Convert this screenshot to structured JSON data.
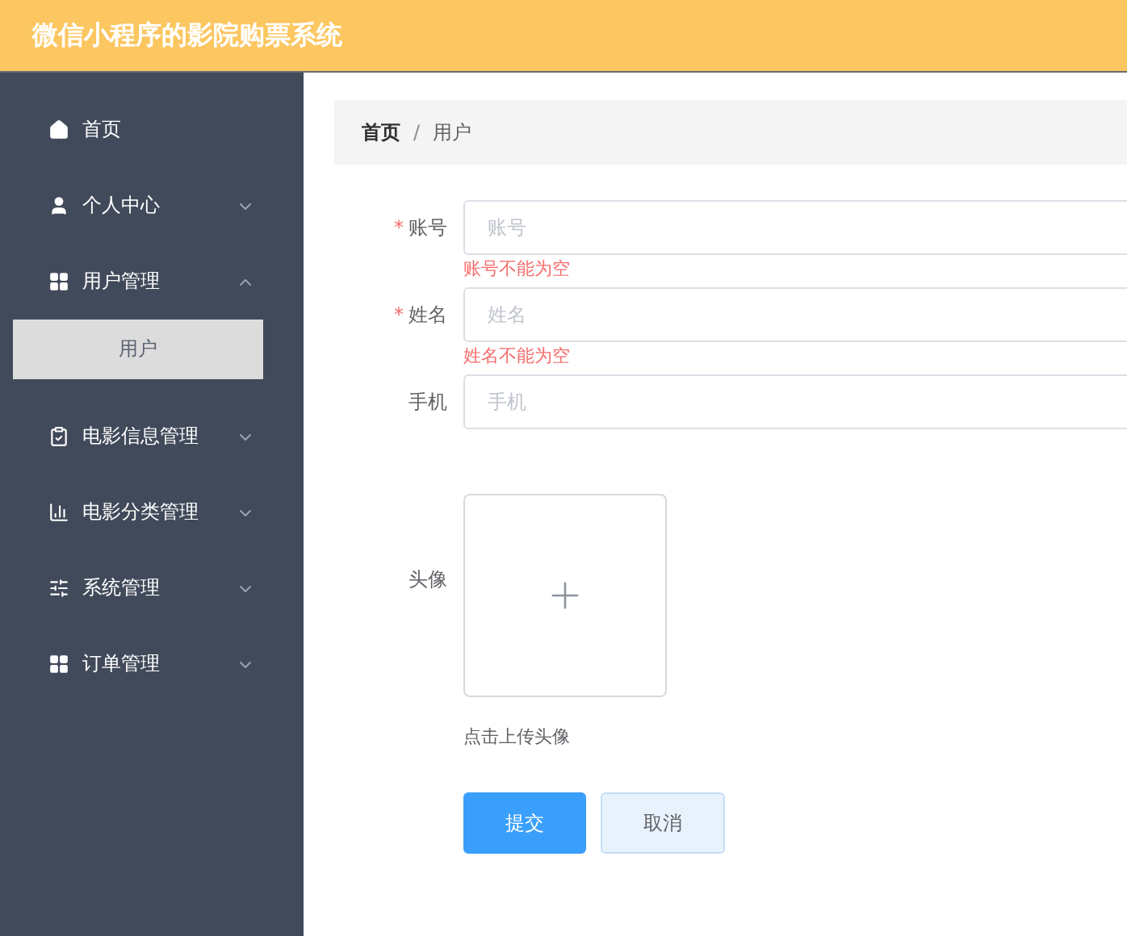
{
  "header": {
    "title": "微信小程序的影院购票系统"
  },
  "sidebar": {
    "items": [
      {
        "label": "首页",
        "kind": "link"
      },
      {
        "label": "个人中心",
        "kind": "submenu",
        "expanded": false
      },
      {
        "label": "用户管理",
        "kind": "submenu",
        "expanded": true,
        "children": [
          {
            "label": "用户",
            "selected": true
          }
        ]
      },
      {
        "label": "电影信息管理",
        "kind": "submenu",
        "expanded": false
      },
      {
        "label": "电影分类管理",
        "kind": "submenu",
        "expanded": false
      },
      {
        "label": "系统管理",
        "kind": "submenu",
        "expanded": false
      },
      {
        "label": "订单管理",
        "kind": "submenu",
        "expanded": false
      }
    ]
  },
  "breadcrumb": {
    "items": [
      "首页",
      "用户"
    ],
    "separator": "/"
  },
  "form": {
    "required_mark": "*",
    "fields": [
      {
        "label": "账号",
        "required": true,
        "placeholder": "账号",
        "error": "账号不能为空"
      },
      {
        "label": "姓名",
        "required": true,
        "placeholder": "姓名",
        "error": "姓名不能为空"
      },
      {
        "label": "手机",
        "required": false,
        "placeholder": "手机"
      }
    ],
    "upload": {
      "label": "头像",
      "hint": "点击上传头像"
    },
    "buttons": [
      {
        "label": "提交",
        "kind": "primary"
      },
      {
        "label": "取消",
        "kind": "secondary"
      }
    ]
  }
}
